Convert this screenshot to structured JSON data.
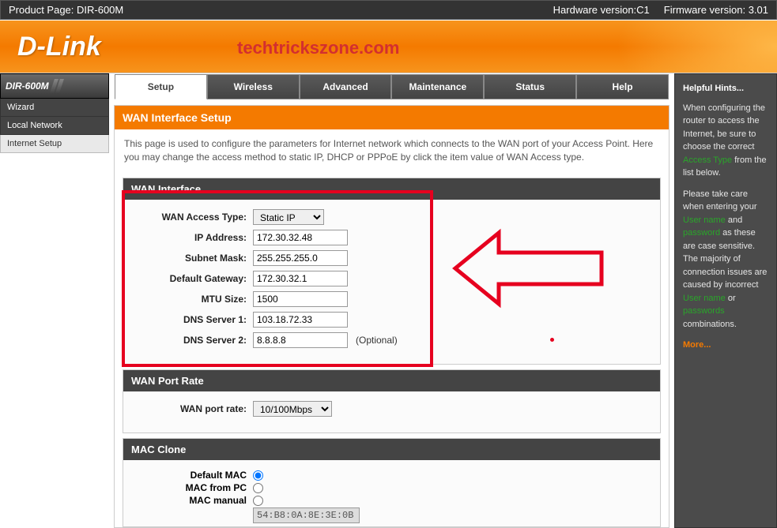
{
  "topbar": {
    "product_label": "Product Page: DIR-600M",
    "hw_label": "Hardware version:C1",
    "fw_label": "Firmware version: 3.01"
  },
  "header": {
    "brand": "D-Link",
    "watermark": "techtrickszone.com"
  },
  "sidebar": {
    "model": "DIR-600M",
    "items": [
      "Wizard",
      "Local Network",
      "Internet Setup"
    ]
  },
  "tabs": [
    "Setup",
    "Wireless",
    "Advanced",
    "Maintenance",
    "Status",
    "Help"
  ],
  "active_tab": "Setup",
  "content": {
    "title": "WAN Interface Setup",
    "desc": "This page is used to configure the parameters for Internet network which connects to the WAN port of your Access Point. Here you may change the access method to static IP, DHCP or PPPoE by click the item value of WAN Access type."
  },
  "wan_iface": {
    "header": "WAN Interface",
    "access_type_label": "WAN Access Type:",
    "access_type_value": "Static IP",
    "ip_label": "IP Address:",
    "ip_value": "172.30.32.48",
    "mask_label": "Subnet Mask:",
    "mask_value": "255.255.255.0",
    "gw_label": "Default Gateway:",
    "gw_value": "172.30.32.1",
    "mtu_label": "MTU Size:",
    "mtu_value": "1500",
    "dns1_label": "DNS Server 1:",
    "dns1_value": "103.18.72.33",
    "dns2_label": "DNS Server 2:",
    "dns2_value": "8.8.8.8",
    "optional_text": "(Optional)"
  },
  "wan_port": {
    "header": "WAN Port Rate",
    "rate_label": "WAN port rate:",
    "rate_value": "10/100Mbps"
  },
  "mac_clone": {
    "header": "MAC Clone",
    "default_label": "Default MAC",
    "from_pc_label": "MAC from PC",
    "manual_label": "MAC manual",
    "mac_value": "54:B8:0A:8E:3E:0B"
  },
  "hints": {
    "title": "Helpful Hints...",
    "p1a": "When configuring the router to access the Internet, be sure to choose the correct ",
    "access_type": "Access Type",
    "p1b": " from the list below.",
    "p2a": "Please take care when entering your ",
    "user_name": "User name",
    "and": " and ",
    "password": "password",
    "p2b": " as these are case sensitive. The majority of connection issues are caused by incorrect ",
    "user_name2": "User name",
    "or": " or ",
    "passwords": "passwords",
    "p2c": " combinations.",
    "more": "More..."
  }
}
